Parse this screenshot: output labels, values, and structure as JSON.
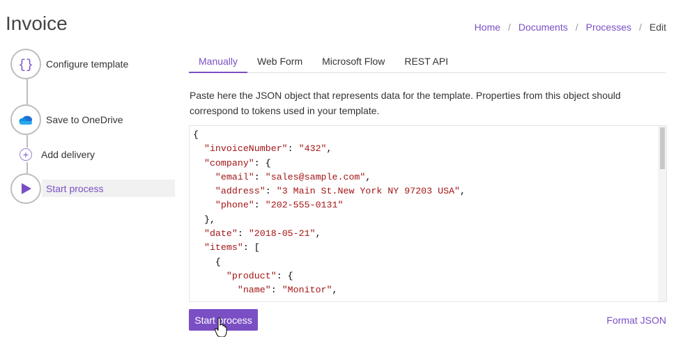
{
  "page": {
    "title": "Invoice"
  },
  "breadcrumb": {
    "items": [
      "Home",
      "Documents",
      "Processes"
    ],
    "current": "Edit",
    "separator": "/"
  },
  "steps": [
    {
      "label": "Configure template",
      "icon": "braces-icon"
    },
    {
      "label": "Save to OneDrive",
      "icon": "onedrive-cloud-icon"
    },
    {
      "label": "Add delivery",
      "icon": "plus-icon"
    },
    {
      "label": "Start process",
      "icon": "play-icon",
      "active": true
    }
  ],
  "tabs": [
    "Manually",
    "Web Form",
    "Microsoft Flow",
    "REST API"
  ],
  "active_tab": "Manually",
  "description": "Paste here the JSON object that represents data for the template. Properties from this object should correspond to tokens used in your template.",
  "editor": {
    "lines": [
      "{",
      "  \"invoiceNumber\": \"432\",",
      "  \"company\": {",
      "    \"email\": \"sales@sample.com\",",
      "    \"address\": \"3 Main St.New York NY 97203 USA\",",
      "    \"phone\": \"202-555-0131\"",
      "  },",
      "  \"date\": \"2018-05-21\",",
      "  \"items\": [",
      "    {",
      "      \"product\": {",
      "        \"name\": \"Monitor\","
    ]
  },
  "buttons": {
    "start": "Start process",
    "format": "Format JSON"
  },
  "colors": {
    "accent": "#7a4fc4",
    "string": "#a31515",
    "onedrive": "#1e6fd0"
  }
}
